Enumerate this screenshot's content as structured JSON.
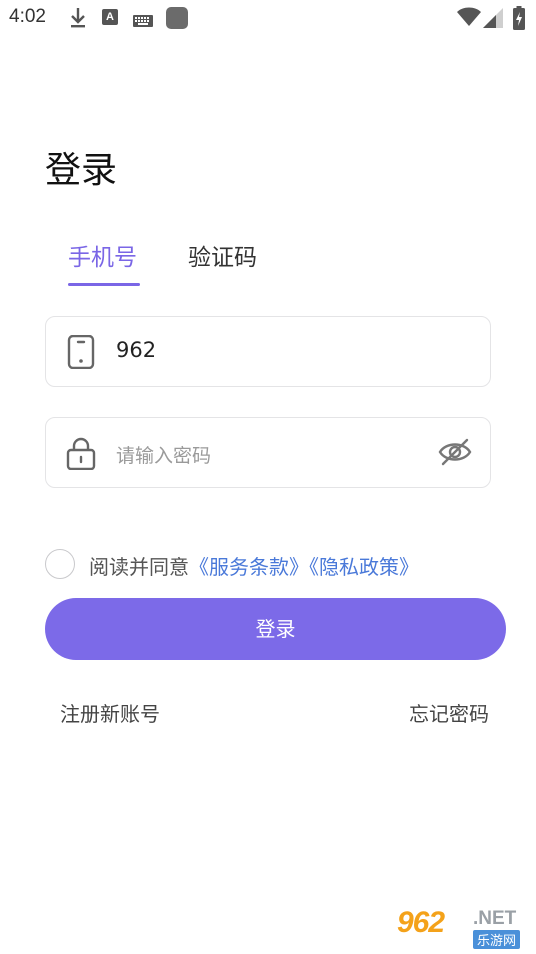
{
  "status_bar": {
    "time": "4:02",
    "keyboard_badge": "A",
    "icons": [
      "download-icon",
      "a-badge-icon",
      "keyboard-icon",
      "app-square-icon",
      "wifi-icon",
      "cell-signal-icon",
      "battery-charging-icon"
    ]
  },
  "page": {
    "title": "登录"
  },
  "tabs": [
    {
      "label": "手机号",
      "active": true
    },
    {
      "label": "验证码",
      "active": false
    }
  ],
  "phone_field": {
    "value": "962",
    "icon": "phone-icon"
  },
  "password_field": {
    "placeholder": "请输入密码",
    "icon": "lock-icon",
    "toggle_icon": "eye-off-icon"
  },
  "agreement": {
    "prefix": "阅读并同意",
    "terms_link": "《服务条款》",
    "privacy_link": "《隐私政策》",
    "checked": false
  },
  "login_button": {
    "label": "登录"
  },
  "links": {
    "register": "注册新账号",
    "forgot_password": "忘记密码"
  },
  "watermark": {
    "number": "962",
    "domain": ".NET",
    "chinese": "乐游网"
  },
  "colors": {
    "accent": "#7c6ae8",
    "tab_active": "#7a66e6",
    "link": "#4a79d9",
    "placeholder": "#9a9a9a",
    "border": "#e4e4e6"
  }
}
